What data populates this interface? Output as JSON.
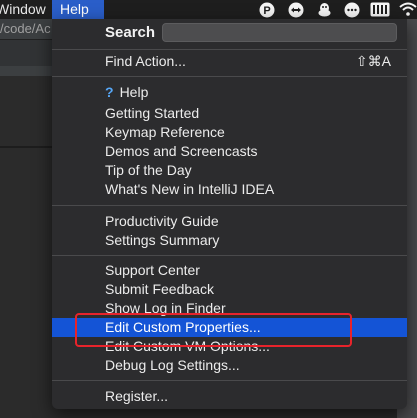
{
  "menubar": {
    "window_label": "Window",
    "help_label": "Help"
  },
  "status_icons": [
    "p-badge-icon",
    "teamviewer-icon",
    "qq-penguin-icon",
    "ellipsis-icon",
    "keyboard-icon",
    "wifi-icon"
  ],
  "background": {
    "path_text": "/code/Ac"
  },
  "menu": {
    "search_label": "Search",
    "search_value": "",
    "find_action": {
      "label": "Find Action...",
      "shortcut": "⇧⌘A"
    },
    "group_help": [
      "Help",
      "Getting Started",
      "Keymap Reference",
      "Demos and Screencasts",
      "Tip of the Day",
      "What's New in IntelliJ IDEA"
    ],
    "group_productivity": [
      "Productivity Guide",
      "Settings Summary"
    ],
    "group_support": [
      "Support Center",
      "Submit Feedback",
      "Show Log in Finder",
      "Edit Custom Properties...",
      "Edit Custom VM Options...",
      "Debug Log Settings..."
    ],
    "selected_item": "Edit Custom Properties...",
    "register": "Register..."
  },
  "colors": {
    "selection": "#1454d6",
    "menu_bg": "#2c2c2e",
    "annotation": "#e8232b",
    "help_icon": "#56a6f5"
  }
}
